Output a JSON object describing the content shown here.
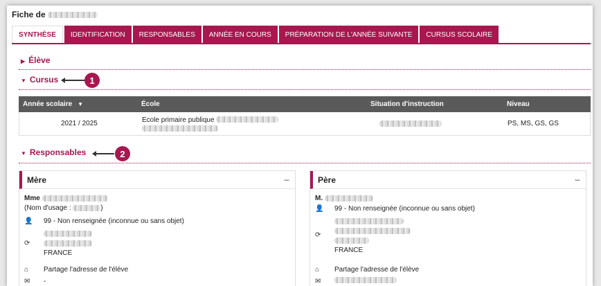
{
  "header": {
    "title": "Fiche de"
  },
  "tabs": [
    {
      "label": "SYNTHÈSE"
    },
    {
      "label": "IDENTIFICATION"
    },
    {
      "label": "RESPONSABLES"
    },
    {
      "label": "ANNÉE EN COURS"
    },
    {
      "label": "PRÉPARATION DE L'ANNÉE SUIVANTE"
    },
    {
      "label": "CURSUS SCOLAIRE"
    }
  ],
  "sections": {
    "eleve": "Élève",
    "cursus": "Cursus",
    "responsables": "Responsables"
  },
  "callouts": {
    "one": "1",
    "two": "2"
  },
  "table": {
    "headers": [
      "Année scolaire",
      "École",
      "Situation d'instruction",
      "Niveau"
    ],
    "row": {
      "annee": "2021 / 2025",
      "ecole": "Ecole primaire publique",
      "niveau": "PS, MS, GS, GS"
    }
  },
  "mere": {
    "title": "Mère",
    "civilite": "Mme",
    "usage": "(Nom d'usage :",
    "usage_end": ")",
    "profession": "99 - Non renseignée (inconnue ou sans objet)",
    "pays": "FRANCE",
    "adresse": "Partage l'adresse de l'élève",
    "email": "-"
  },
  "pere": {
    "title": "Père",
    "civilite": "M.",
    "profession": "99 - Non renseignée (inconnue ou sans objet)",
    "pays": "FRANCE",
    "adresse": "Partage l'adresse de l'élève"
  },
  "icons": {
    "person": "person-icon",
    "refresh": "refresh-icon",
    "home": "home-icon",
    "mail": "mail-icon"
  },
  "colors": {
    "accent": "#a8174f",
    "table_header": "#5a5a5a"
  }
}
